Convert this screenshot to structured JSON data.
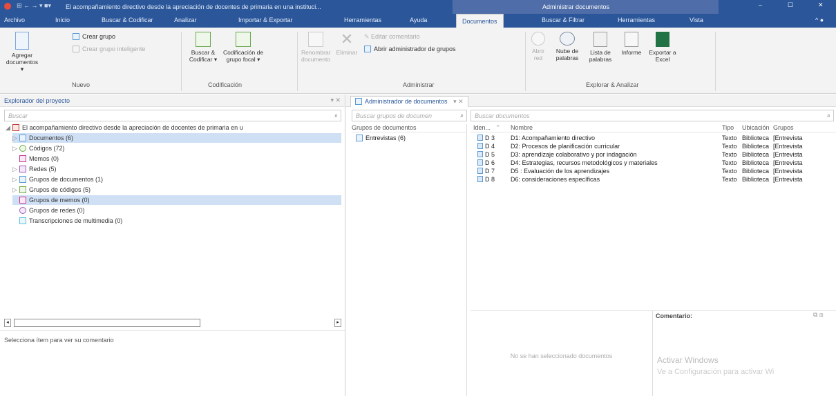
{
  "window": {
    "title": "El acompañamiento directivo desde la apreciación de docentes de primaria en una instituci...",
    "context_title": "Administrar documentos"
  },
  "menu": {
    "items": [
      "Archivo",
      "Inicio",
      "Buscar & Codificar",
      "Analizar",
      "Importar & Exportar",
      "Herramientas",
      "Ayuda",
      "Documentos",
      "Buscar & Filtrar",
      "Herramientas",
      "Vista"
    ],
    "active": "Documentos"
  },
  "ribbon": {
    "nuevo": {
      "add_docs": "Agregar documentos",
      "create_group": "Crear grupo",
      "create_smart_group": "Crear grupo inteligente",
      "label": "Nuevo"
    },
    "codificacion": {
      "search_code": "Buscar & Codificar",
      "focus_group": "Codificación de grupo focal",
      "label": "Codificación"
    },
    "administrar": {
      "rename": "Renombrar documento",
      "delete": "Eliminar",
      "edit_comment": "Editar comentario",
      "open_group_manager": "Abrir administrador de grupos",
      "label": "Administrar"
    },
    "explorar": {
      "open": "Abrir red",
      "word_cloud": "Nube de palabras",
      "word_list": "Lista de palabras",
      "report": "Informe",
      "export_excel": "Exportar a Excel",
      "label": "Explorar & Analizar"
    }
  },
  "explorer": {
    "title": "Explorador del proyecto",
    "search_placeholder": "Buscar",
    "root": "El acompañamiento directivo desde la apreciación de docentes de primaria en u",
    "items": [
      "Documentos (6)",
      "Códigos (72)",
      "Memos (0)",
      "Redes (5)",
      "Grupos de documentos (1)",
      "Grupos de códigos (5)",
      "Grupos de memos (0)",
      "Grupos de redes (0)",
      "Transcripciones de multimedia (0)"
    ],
    "comment_placeholder": "Selecciona ítem para ver su comentario"
  },
  "manager": {
    "tab": "Administrador de documentos",
    "groups_search": "Buscar grupos de documen",
    "docs_search": "Buscar documentos",
    "groups_header": "Grupos de documentos",
    "group_item": "Entrevistas (6)",
    "columns": [
      "Iden...",
      "Nombre",
      "Tipo",
      "Ubicación",
      "Grupos"
    ],
    "rows": [
      [
        "D 3",
        "D1: Acompañamiento directivo",
        "Texto",
        "Biblioteca",
        "[Entrevista"
      ],
      [
        "D 4",
        "D2: Procesos de planificación curricular",
        "Texto",
        "Biblioteca",
        "[Entrevista"
      ],
      [
        "D 5",
        "D3: aprendizaje colaborativo y por indagación",
        "Texto",
        "Biblioteca",
        "[Entrevista"
      ],
      [
        "D 6",
        "D4: Estrategias, recursos metodológicos y materiales",
        "Texto",
        "Biblioteca",
        "[Entrevista"
      ],
      [
        "D 7",
        "D5 : Evaluación de los aprendizajes",
        "Texto",
        "Biblioteca",
        "[Entrevista"
      ],
      [
        "D 8",
        "D6: consideraciones específicas",
        "Texto",
        "Biblioteca",
        "[Entrevista"
      ]
    ],
    "no_selection": "No se han seleccionado documentos",
    "comment_title": "Comentario:",
    "activation_1": "Activar Windows",
    "activation_2": "Ve a Configuración para activar Wi"
  }
}
